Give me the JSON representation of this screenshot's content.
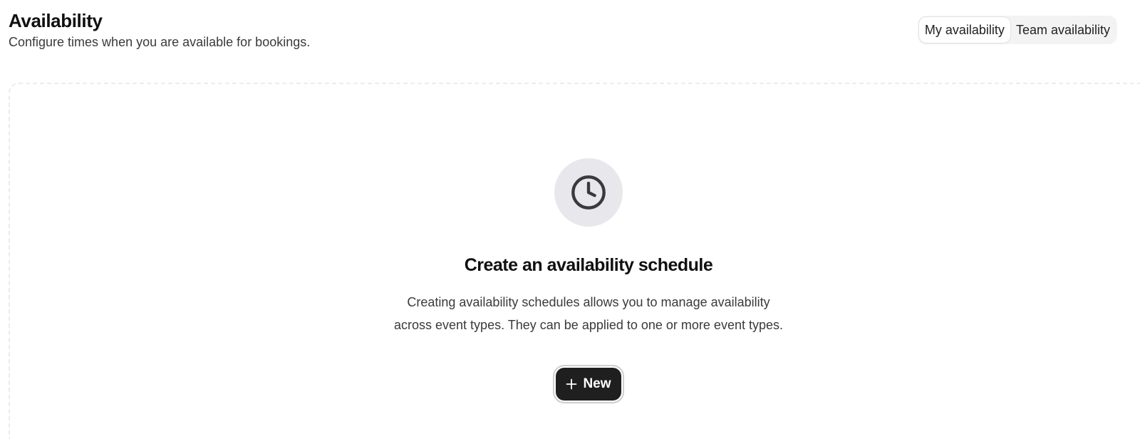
{
  "header": {
    "title": "Availability",
    "subtitle": "Configure times when you are available for bookings."
  },
  "view_toggle": {
    "options": [
      {
        "label": "My availability",
        "active": true
      },
      {
        "label": "Team availability",
        "active": false
      }
    ]
  },
  "empty_state": {
    "icon": "clock-icon",
    "title": "Create an availability schedule",
    "description": "Creating availability schedules allows you to manage availability across event types. They can be applied to one or more event types.",
    "button_label": "New",
    "button_icon": "plus-icon"
  },
  "colors": {
    "button_bg": "#1f1f1f",
    "icon_circle_bg": "#e8e8ec",
    "toggle_bg": "#f3f3f4"
  }
}
